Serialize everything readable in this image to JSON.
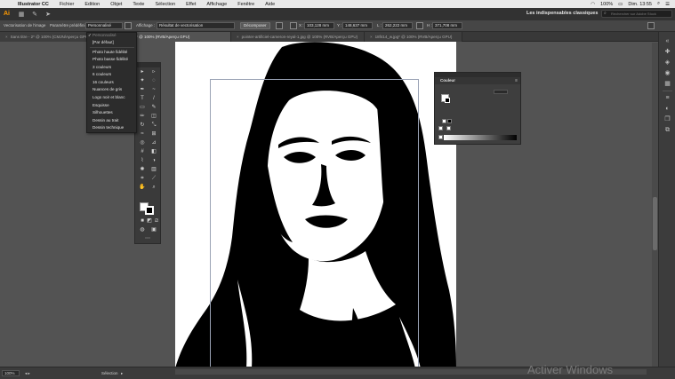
{
  "menubar": {
    "app": "Illustrator CC",
    "items": [
      "Fichier",
      "Edition",
      "Objet",
      "Texte",
      "Sélection",
      "Effet",
      "Affichage",
      "Fenêtre",
      "Aide"
    ],
    "clock": "Dim. 13:55",
    "battery": "100%"
  },
  "appbar": {
    "logo": "Ai",
    "workspace": "Les indispensables classiques",
    "search_placeholder": "Rechercher sur Adobe Stock"
  },
  "controlbar": {
    "label_vectorisation": "Vectorisation de l'image",
    "label_parametre": "Paramètre prédéfini :",
    "preset_value": "Personnalisé",
    "label_affichage": "Affichage :",
    "affichage_value": "Résultat de vectorisation",
    "decompose_button": "Décomposer",
    "x_label": "X :",
    "x_value": "103,128 mm",
    "y_label": "Y :",
    "y_value": "148,637 mm",
    "l_label": "L :",
    "l_value": "262,222 mm",
    "h_label": "H :",
    "h_value": "371,708 mm"
  },
  "tabs": [
    {
      "label": "Sans titre - 2* @ 100% (CMJN/Aperçu GPU)",
      "active": false
    },
    {
      "label": "cAdc15a2d1.0b.jpg* @ 100% (RVB/Aperçu GPU)",
      "active": true
    },
    {
      "label": "pointer-artificiel-cameron-reyal-1.jpg @ 100% (RVB/Aperçu GPU)",
      "active": false
    },
    {
      "label": "18f414_w.jpg* @ 100% (RVB/Aperçu GPU)",
      "active": false
    }
  ],
  "dropdown": {
    "items": [
      {
        "label": "Personnalisé",
        "disabled": true,
        "checked": true
      },
      {
        "label": "[Par défaut]",
        "disabled": false
      },
      {
        "label": "Photo haute fidélité",
        "disabled": false
      },
      {
        "label": "Photo basse fidélité",
        "disabled": false
      },
      {
        "label": "3 couleurs",
        "disabled": false
      },
      {
        "label": "6 couleurs",
        "disabled": false
      },
      {
        "label": "16 couleurs",
        "disabled": false
      },
      {
        "label": "Nuances de gris",
        "disabled": false
      },
      {
        "label": "Logo noir et blanc",
        "disabled": false
      },
      {
        "label": "Esquisse",
        "disabled": false
      },
      {
        "label": "Silhouettes",
        "disabled": false
      },
      {
        "label": "Dessin au trait",
        "disabled": false
      },
      {
        "label": "Dessin technique",
        "disabled": false
      }
    ]
  },
  "couleur_panel": {
    "title": "Couleur"
  },
  "statusbar": {
    "zoom": "100%",
    "tool": "Sélection"
  },
  "watermark": "Activer Windows",
  "colors": {
    "ui_dark": "#323232",
    "ui_mid": "#464646",
    "canvas_bg": "#535353",
    "artboard": "#ffffff",
    "artwork": "#000000",
    "frame": "#9aa3b5"
  }
}
